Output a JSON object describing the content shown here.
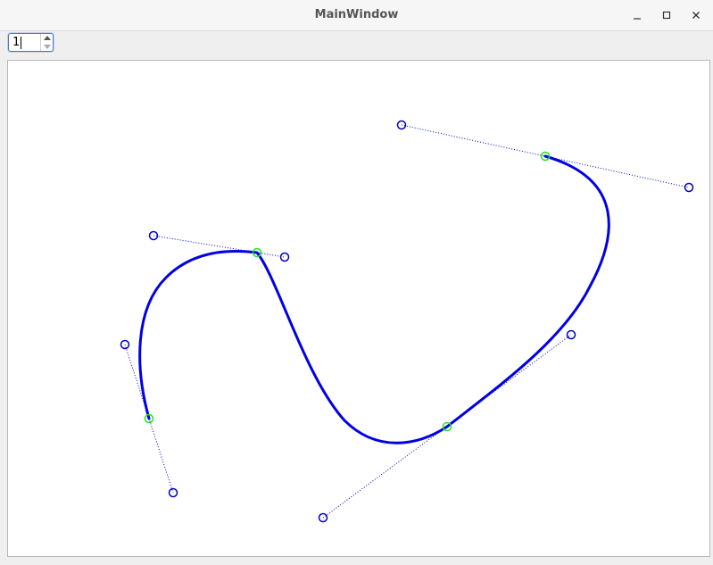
{
  "window": {
    "title": "MainWindow"
  },
  "toolbar": {
    "spinbox_value": "1"
  },
  "colors": {
    "curve": "#0000e6",
    "anchor": "#1ee61e",
    "control": "#0000c8",
    "handle_line": "#0000c8"
  },
  "icons": {
    "minimize": "minimize-icon",
    "maximize": "maximize-icon",
    "close": "close-icon",
    "spin_up": "triangle-up-icon",
    "spin_down": "triangle-down-icon"
  }
}
